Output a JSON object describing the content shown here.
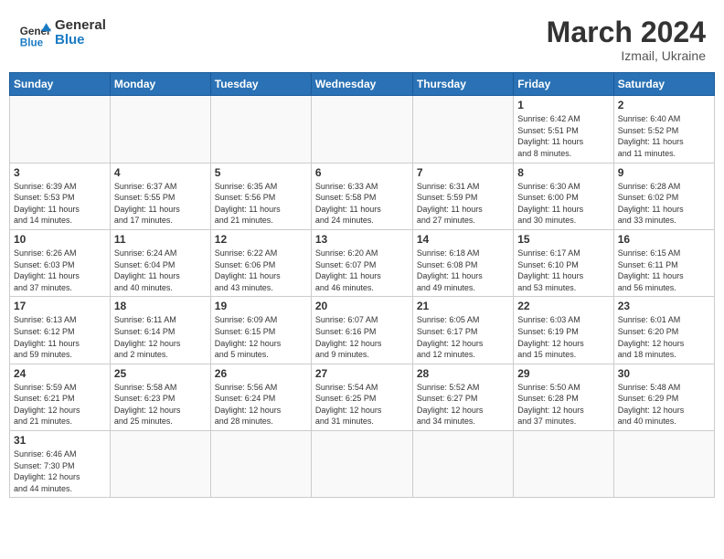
{
  "header": {
    "logo_general": "General",
    "logo_blue": "Blue",
    "month": "March 2024",
    "location": "Izmail, Ukraine"
  },
  "weekdays": [
    "Sunday",
    "Monday",
    "Tuesday",
    "Wednesday",
    "Thursday",
    "Friday",
    "Saturday"
  ],
  "weeks": [
    [
      {
        "day": "",
        "info": ""
      },
      {
        "day": "",
        "info": ""
      },
      {
        "day": "",
        "info": ""
      },
      {
        "day": "",
        "info": ""
      },
      {
        "day": "",
        "info": ""
      },
      {
        "day": "1",
        "info": "Sunrise: 6:42 AM\nSunset: 5:51 PM\nDaylight: 11 hours\nand 8 minutes."
      },
      {
        "day": "2",
        "info": "Sunrise: 6:40 AM\nSunset: 5:52 PM\nDaylight: 11 hours\nand 11 minutes."
      }
    ],
    [
      {
        "day": "3",
        "info": "Sunrise: 6:39 AM\nSunset: 5:53 PM\nDaylight: 11 hours\nand 14 minutes."
      },
      {
        "day": "4",
        "info": "Sunrise: 6:37 AM\nSunset: 5:55 PM\nDaylight: 11 hours\nand 17 minutes."
      },
      {
        "day": "5",
        "info": "Sunrise: 6:35 AM\nSunset: 5:56 PM\nDaylight: 11 hours\nand 21 minutes."
      },
      {
        "day": "6",
        "info": "Sunrise: 6:33 AM\nSunset: 5:58 PM\nDaylight: 11 hours\nand 24 minutes."
      },
      {
        "day": "7",
        "info": "Sunrise: 6:31 AM\nSunset: 5:59 PM\nDaylight: 11 hours\nand 27 minutes."
      },
      {
        "day": "8",
        "info": "Sunrise: 6:30 AM\nSunset: 6:00 PM\nDaylight: 11 hours\nand 30 minutes."
      },
      {
        "day": "9",
        "info": "Sunrise: 6:28 AM\nSunset: 6:02 PM\nDaylight: 11 hours\nand 33 minutes."
      }
    ],
    [
      {
        "day": "10",
        "info": "Sunrise: 6:26 AM\nSunset: 6:03 PM\nDaylight: 11 hours\nand 37 minutes."
      },
      {
        "day": "11",
        "info": "Sunrise: 6:24 AM\nSunset: 6:04 PM\nDaylight: 11 hours\nand 40 minutes."
      },
      {
        "day": "12",
        "info": "Sunrise: 6:22 AM\nSunset: 6:06 PM\nDaylight: 11 hours\nand 43 minutes."
      },
      {
        "day": "13",
        "info": "Sunrise: 6:20 AM\nSunset: 6:07 PM\nDaylight: 11 hours\nand 46 minutes."
      },
      {
        "day": "14",
        "info": "Sunrise: 6:18 AM\nSunset: 6:08 PM\nDaylight: 11 hours\nand 49 minutes."
      },
      {
        "day": "15",
        "info": "Sunrise: 6:17 AM\nSunset: 6:10 PM\nDaylight: 11 hours\nand 53 minutes."
      },
      {
        "day": "16",
        "info": "Sunrise: 6:15 AM\nSunset: 6:11 PM\nDaylight: 11 hours\nand 56 minutes."
      }
    ],
    [
      {
        "day": "17",
        "info": "Sunrise: 6:13 AM\nSunset: 6:12 PM\nDaylight: 11 hours\nand 59 minutes."
      },
      {
        "day": "18",
        "info": "Sunrise: 6:11 AM\nSunset: 6:14 PM\nDaylight: 12 hours\nand 2 minutes."
      },
      {
        "day": "19",
        "info": "Sunrise: 6:09 AM\nSunset: 6:15 PM\nDaylight: 12 hours\nand 5 minutes."
      },
      {
        "day": "20",
        "info": "Sunrise: 6:07 AM\nSunset: 6:16 PM\nDaylight: 12 hours\nand 9 minutes."
      },
      {
        "day": "21",
        "info": "Sunrise: 6:05 AM\nSunset: 6:17 PM\nDaylight: 12 hours\nand 12 minutes."
      },
      {
        "day": "22",
        "info": "Sunrise: 6:03 AM\nSunset: 6:19 PM\nDaylight: 12 hours\nand 15 minutes."
      },
      {
        "day": "23",
        "info": "Sunrise: 6:01 AM\nSunset: 6:20 PM\nDaylight: 12 hours\nand 18 minutes."
      }
    ],
    [
      {
        "day": "24",
        "info": "Sunrise: 5:59 AM\nSunset: 6:21 PM\nDaylight: 12 hours\nand 21 minutes."
      },
      {
        "day": "25",
        "info": "Sunrise: 5:58 AM\nSunset: 6:23 PM\nDaylight: 12 hours\nand 25 minutes."
      },
      {
        "day": "26",
        "info": "Sunrise: 5:56 AM\nSunset: 6:24 PM\nDaylight: 12 hours\nand 28 minutes."
      },
      {
        "day": "27",
        "info": "Sunrise: 5:54 AM\nSunset: 6:25 PM\nDaylight: 12 hours\nand 31 minutes."
      },
      {
        "day": "28",
        "info": "Sunrise: 5:52 AM\nSunset: 6:27 PM\nDaylight: 12 hours\nand 34 minutes."
      },
      {
        "day": "29",
        "info": "Sunrise: 5:50 AM\nSunset: 6:28 PM\nDaylight: 12 hours\nand 37 minutes."
      },
      {
        "day": "30",
        "info": "Sunrise: 5:48 AM\nSunset: 6:29 PM\nDaylight: 12 hours\nand 40 minutes."
      }
    ],
    [
      {
        "day": "31",
        "info": "Sunrise: 6:46 AM\nSunset: 7:30 PM\nDaylight: 12 hours\nand 44 minutes."
      },
      {
        "day": "",
        "info": ""
      },
      {
        "day": "",
        "info": ""
      },
      {
        "day": "",
        "info": ""
      },
      {
        "day": "",
        "info": ""
      },
      {
        "day": "",
        "info": ""
      },
      {
        "day": "",
        "info": ""
      }
    ]
  ]
}
